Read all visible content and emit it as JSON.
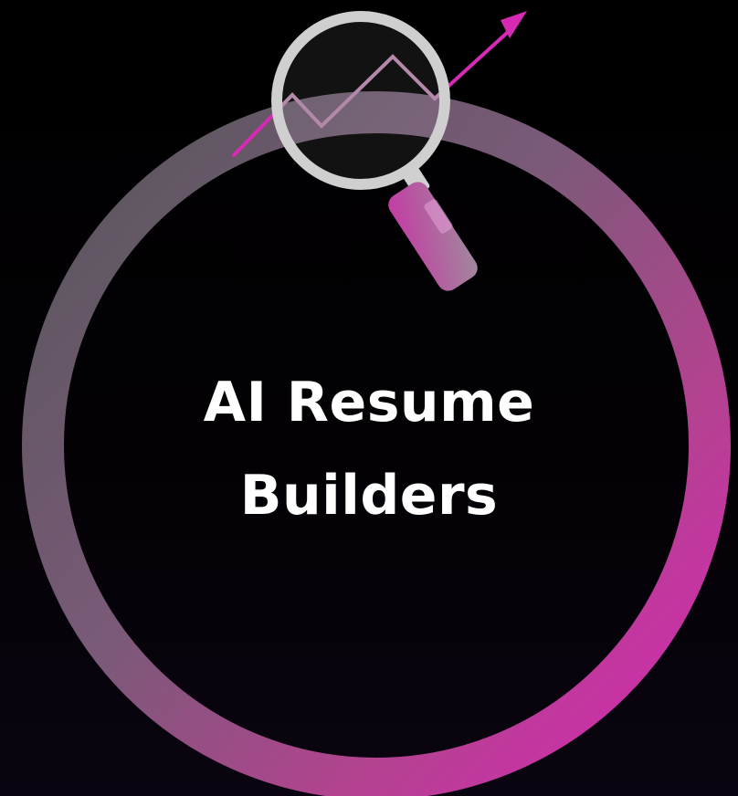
{
  "hero": {
    "title_line_1": "AI Resume",
    "title_line_2": "Builders"
  },
  "icons": [
    "trend-up-arrow-icon",
    "magnifying-glass-icon"
  ],
  "colors": {
    "background": "#000000",
    "ring_start": "#5a5a5e",
    "ring_end": "#cc2fa8",
    "accent_magenta": "#d62ab4",
    "glass_rim": "#cfcfcf",
    "title_text": "#ffffff"
  }
}
